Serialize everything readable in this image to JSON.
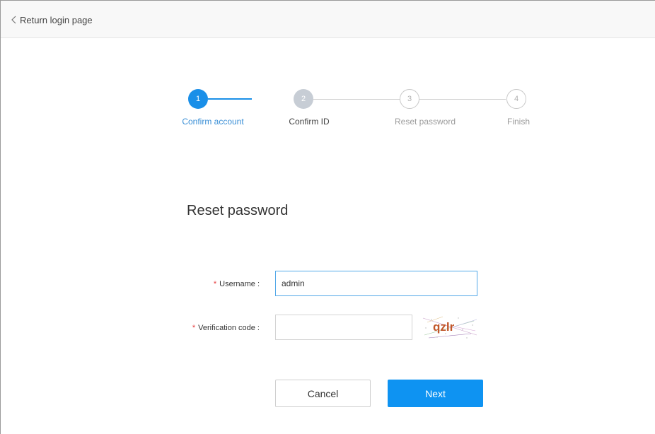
{
  "header": {
    "back_label": "Return login page",
    "back_icon": "chevron-left-icon"
  },
  "stepper": {
    "steps": [
      {
        "number": "1",
        "label": "Confirm account",
        "state": "done"
      },
      {
        "number": "2",
        "label": "Confirm ID",
        "state": "current"
      },
      {
        "number": "3",
        "label": "Reset password",
        "state": "todo"
      },
      {
        "number": "4",
        "label": "Finish",
        "state": "todo"
      }
    ]
  },
  "form": {
    "title": "Reset password",
    "username": {
      "label": "Username :",
      "value": "admin",
      "required_mark": "*"
    },
    "verification": {
      "label": "Verification code :",
      "value": "",
      "required_mark": "*",
      "captcha_text": "qzlr"
    }
  },
  "actions": {
    "cancel_label": "Cancel",
    "next_label": "Next"
  },
  "colors": {
    "primary": "#0e93f2",
    "step_active": "#1a8fe8",
    "required": "#e5393b"
  }
}
